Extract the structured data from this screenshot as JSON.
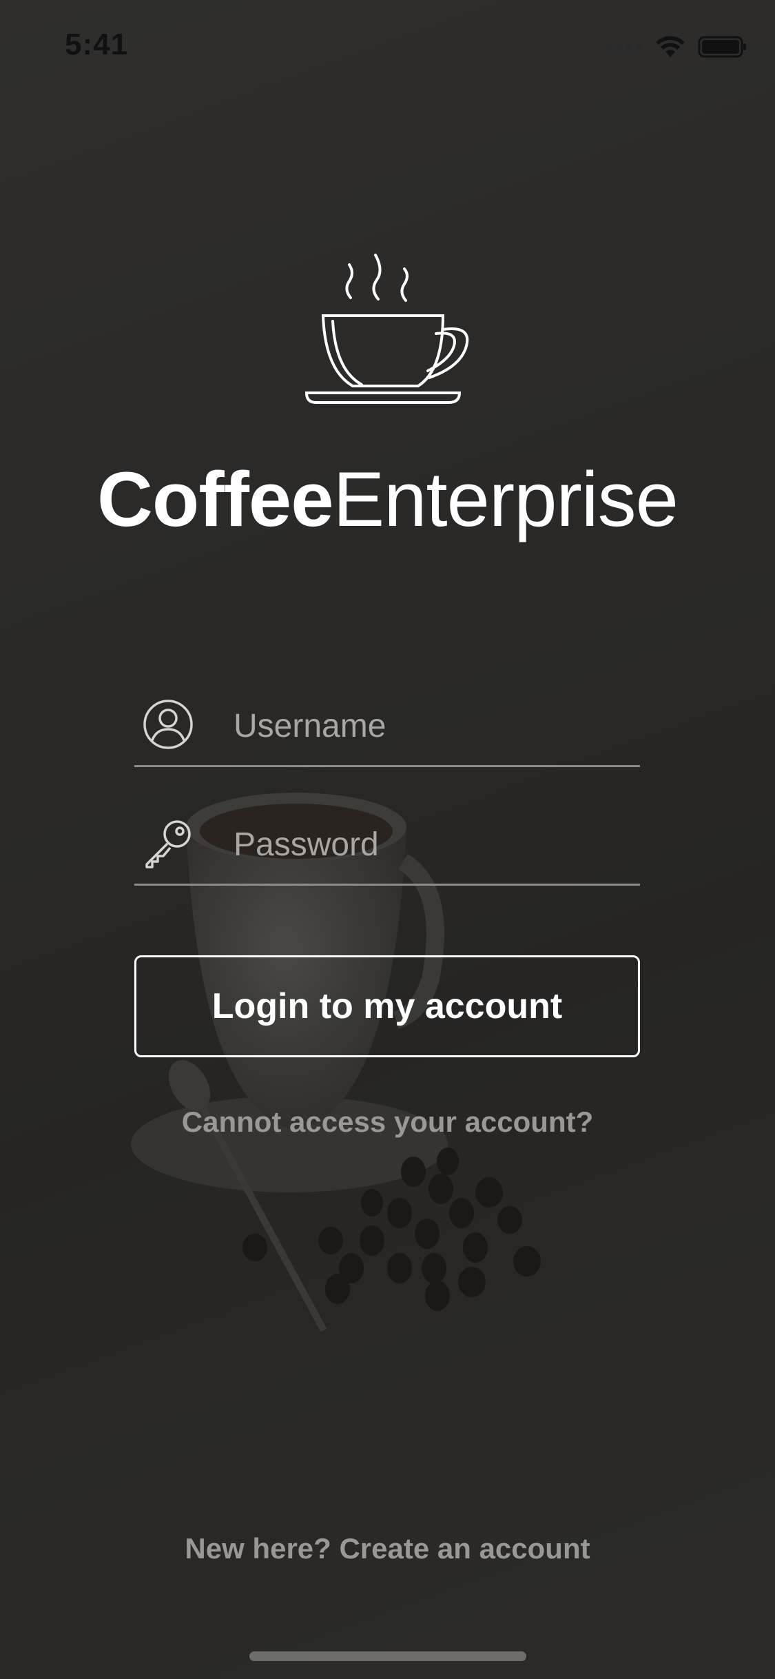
{
  "status_bar": {
    "time": "5:41",
    "icons": [
      "signal-dots-icon",
      "wifi-icon",
      "battery-icon"
    ]
  },
  "brand": {
    "logo_icon": "coffee-cup-icon",
    "name_bold": "Coffee",
    "name_light": "Enterprise"
  },
  "login_form": {
    "username": {
      "placeholder": "Username",
      "value": "",
      "icon": "user-circle-icon"
    },
    "password": {
      "placeholder": "Password",
      "value": "",
      "icon": "key-icon"
    },
    "submit_label": "Login to my account",
    "forgot_label": "Cannot access your account?"
  },
  "footer": {
    "create_account_label": "New here? Create an account"
  },
  "colors": {
    "background": "#2b2a28",
    "text_primary": "#ffffff",
    "text_muted": "#9a9895",
    "divider": "#8e8c89"
  }
}
